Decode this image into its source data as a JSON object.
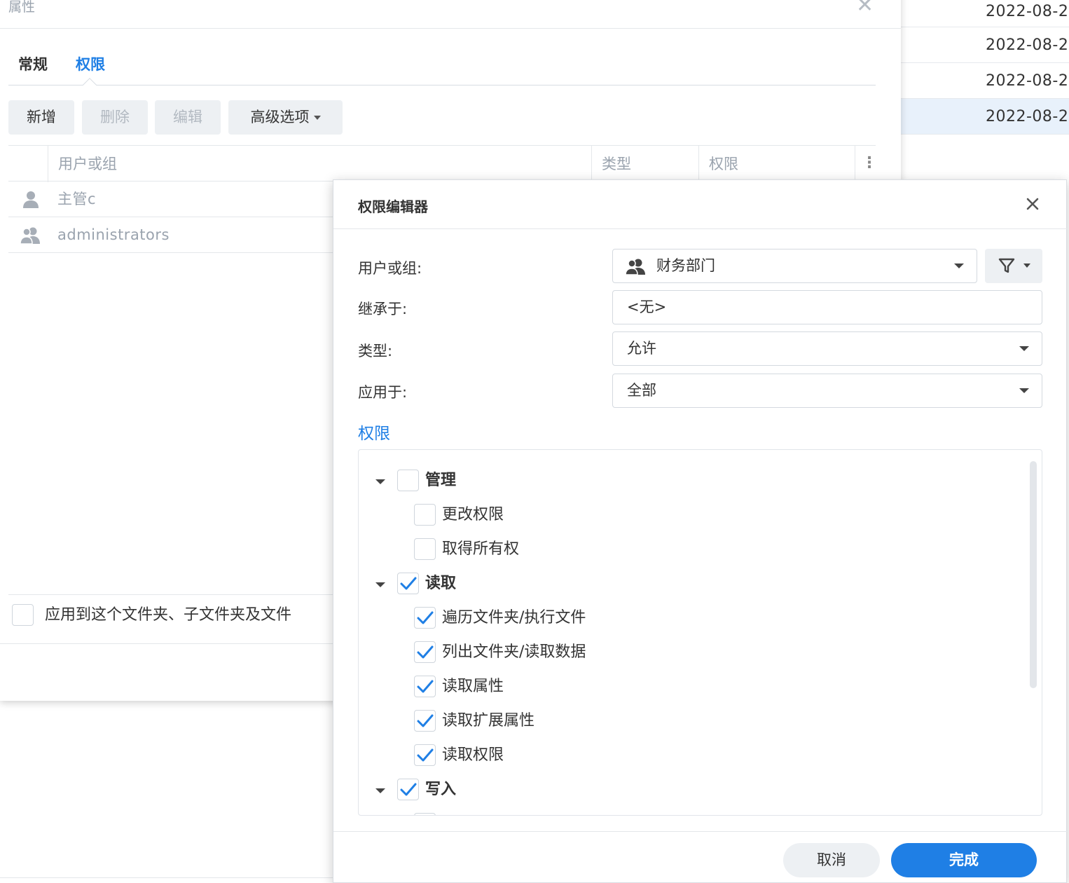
{
  "background_list": {
    "dates": [
      "2022-08-2",
      "2022-08-2",
      "2022-08-2",
      "2022-08-2"
    ]
  },
  "properties": {
    "title": "属性",
    "tabs": [
      "常规",
      "权限"
    ],
    "active_tab": "权限",
    "toolbar": {
      "add": "新增",
      "delete": "删除",
      "edit": "编辑",
      "advanced": "高级选项"
    },
    "columns": [
      "用户或组",
      "类型",
      "权限"
    ],
    "rows": [
      {
        "name": "主管c",
        "icon": "user-icon"
      },
      {
        "name": "administrators",
        "icon": "group-icon"
      }
    ],
    "apply_label": "应用到这个文件夹、子文件夹及文件"
  },
  "editor": {
    "title": "权限编辑器",
    "fields": {
      "user_label": "用户或组:",
      "user_value": "财务部门",
      "inherit_label": "继承于:",
      "inherit_value": "<无>",
      "type_label": "类型:",
      "type_value": "允许",
      "apply_label": "应用于:",
      "apply_value": "全部"
    },
    "permissions_heading": "权限",
    "permissions": [
      {
        "label": "管理",
        "level": 0,
        "checked": false,
        "expandable": true
      },
      {
        "label": "更改权限",
        "level": 1,
        "checked": false
      },
      {
        "label": "取得所有权",
        "level": 1,
        "checked": false
      },
      {
        "label": "读取",
        "level": 0,
        "checked": true,
        "expandable": true
      },
      {
        "label": "遍历文件夹/执行文件",
        "level": 1,
        "checked": true
      },
      {
        "label": "列出文件夹/读取数据",
        "level": 1,
        "checked": true
      },
      {
        "label": "读取属性",
        "level": 1,
        "checked": true
      },
      {
        "label": "读取扩展属性",
        "level": 1,
        "checked": true
      },
      {
        "label": "读取权限",
        "level": 1,
        "checked": true
      },
      {
        "label": "写入",
        "level": 0,
        "checked": true,
        "expandable": true
      }
    ],
    "buttons": {
      "cancel": "取消",
      "done": "完成"
    }
  },
  "colors": {
    "accent": "#1f7fe5",
    "selected_row": "#e8f1fb"
  }
}
